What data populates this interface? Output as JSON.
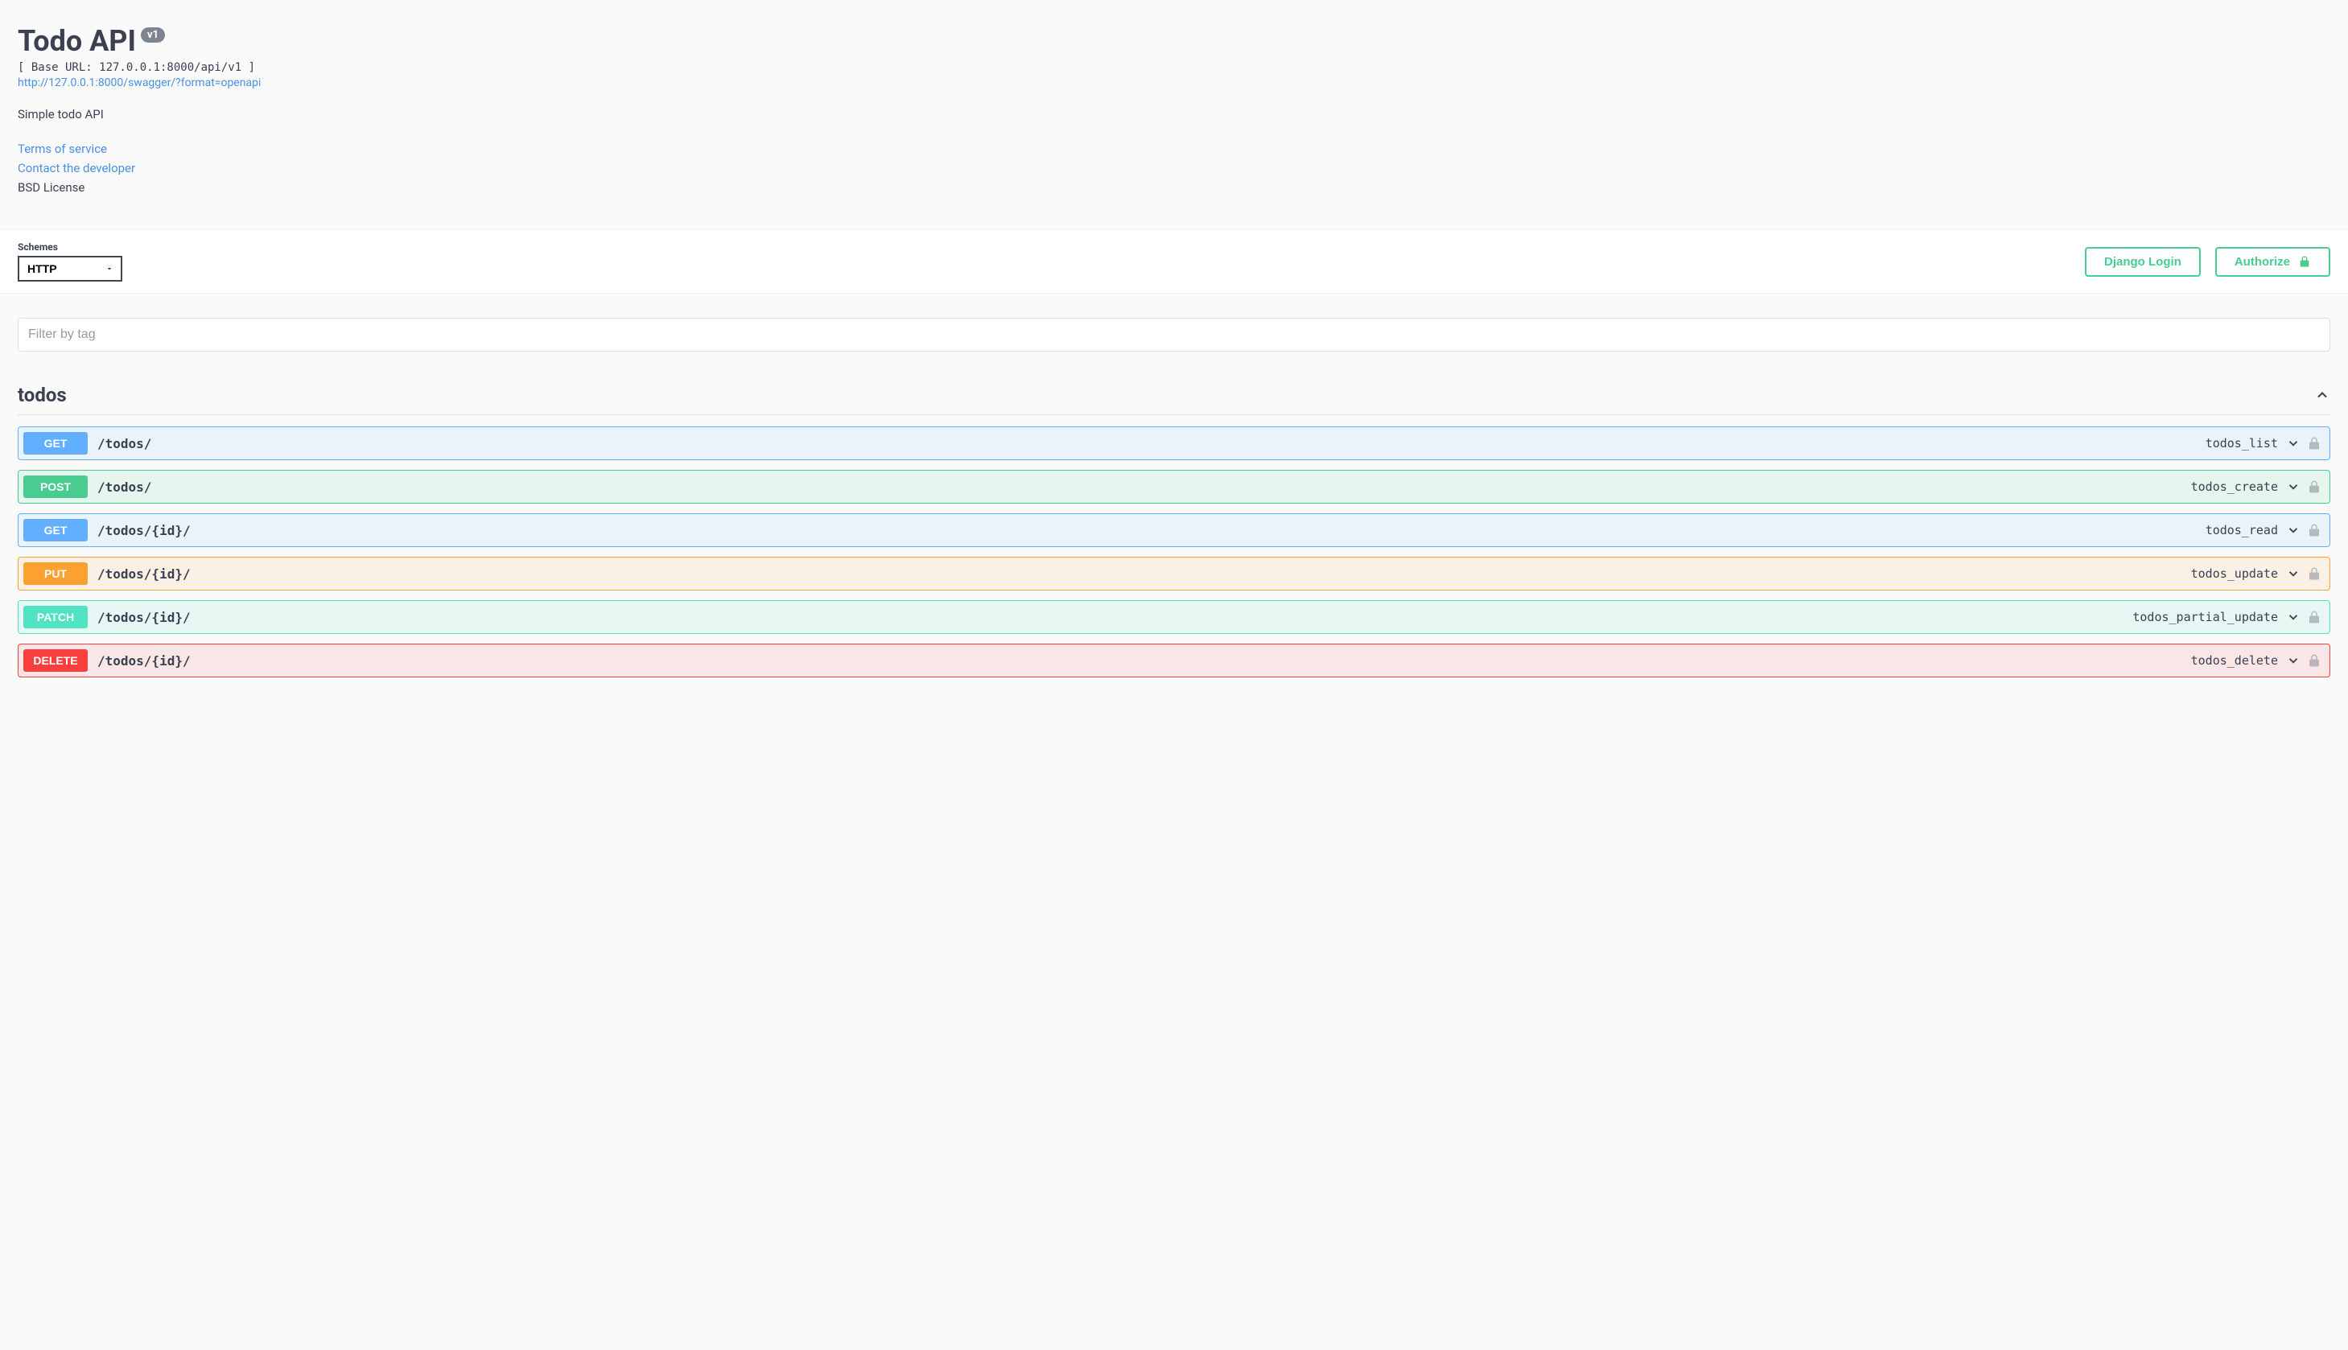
{
  "header": {
    "title": "Todo API",
    "version": "v1",
    "base_url_line": "[ Base URL: 127.0.0.1:8000/api/v1 ]",
    "spec_url": "http://127.0.0.1:8000/swagger/?format=openapi",
    "description": "Simple todo API",
    "terms_label": "Terms of service",
    "contact_label": "Contact the developer",
    "license": "BSD License"
  },
  "schemes": {
    "label": "Schemes",
    "selected": "HTTP",
    "options": [
      "HTTP"
    ]
  },
  "auth": {
    "login_label": "Django Login",
    "authorize_label": "Authorize"
  },
  "filter": {
    "placeholder": "Filter by tag"
  },
  "tag": {
    "name": "todos",
    "expanded": true
  },
  "operations": [
    {
      "method": "GET",
      "path": "/todos/",
      "op_id": "todos_list"
    },
    {
      "method": "POST",
      "path": "/todos/",
      "op_id": "todos_create"
    },
    {
      "method": "GET",
      "path": "/todos/{id}/",
      "op_id": "todos_read"
    },
    {
      "method": "PUT",
      "path": "/todos/{id}/",
      "op_id": "todos_update"
    },
    {
      "method": "PATCH",
      "path": "/todos/{id}/",
      "op_id": "todos_partial_update"
    },
    {
      "method": "DELETE",
      "path": "/todos/{id}/",
      "op_id": "todos_delete"
    }
  ]
}
